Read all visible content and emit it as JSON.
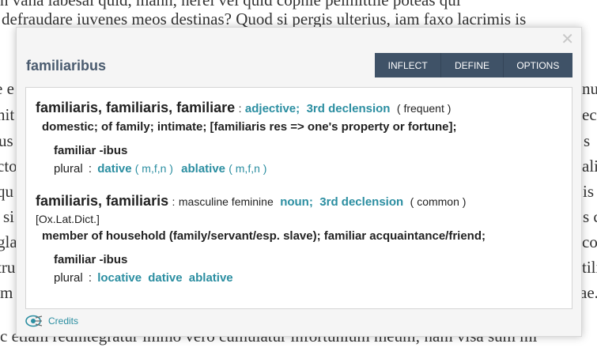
{
  "background": {
    "lines": [
      "n vana labesai quid, mann, nerel vel quid copnie peimittile poteas qui",
      "defraudare iuvenes meos destinas? Quod si pergis ulterius, iam faxo lacrimis is",
      "c etiam redintegratur immo vero cumulatur infortunium meum; nam visa sum mi"
    ],
    "left_fragments": [
      "e e",
      "nit",
      "us",
      "cto",
      "qu",
      "si",
      "gla",
      "tru",
      "m"
    ],
    "right_fragments": [
      "nu",
      "eci",
      "s",
      "ali",
      "is",
      "s c",
      "co",
      "tili",
      "ae."
    ]
  },
  "popup": {
    "headword": "familiaribus",
    "close_symbol": "✕",
    "tabs": [
      "INFLECT",
      "DEFINE",
      "OPTIONS"
    ],
    "entries": [
      {
        "lemma": "familiaris, familiaris, familiare",
        "sep": ":",
        "pos": [
          "adjective;",
          "3rd declension"
        ],
        "frequency": "frequent",
        "source": "",
        "definition": "domestic; of family; intimate; [familiaris res => one's property or fortune];",
        "form_title": "familiar -ibus",
        "number": "plural",
        "cases": [
          {
            "name": "dative",
            "genders": "m,f,n"
          },
          {
            "name": "ablative",
            "genders": "m,f,n"
          }
        ]
      },
      {
        "lemma": "familiaris, familiaris",
        "sep": ":",
        "gender_text": "masculine feminine",
        "pos": [
          "noun;",
          "3rd declension"
        ],
        "frequency": "common",
        "source": "[Ox.Lat.Dict.]",
        "definition": "member of household (family/servant/esp. slave); familiar acquaintance/friend;",
        "form_title": "familiar -ibus",
        "number": "plural",
        "cases": [
          {
            "name": "locative"
          },
          {
            "name": "dative"
          },
          {
            "name": "ablative"
          }
        ]
      }
    ],
    "credits_label": "Credits"
  }
}
